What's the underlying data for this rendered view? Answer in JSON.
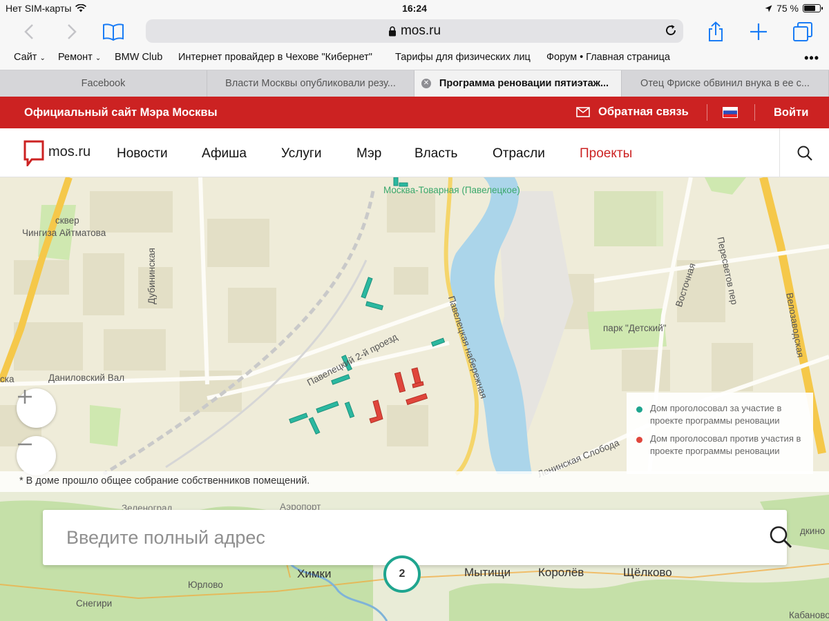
{
  "status_bar": {
    "carrier": "Нет SIM-карты",
    "time": "16:24",
    "battery": "75 %",
    "battery_level": 0.75
  },
  "browser": {
    "url": "mos.ru",
    "bookmarks": [
      "Сайт",
      "Ремонт",
      "BMW Club",
      "Интернет провайдер в Чехове \"Кибернет\"",
      "Тарифы для физических лиц",
      "Форум • Главная страница"
    ],
    "tabs": [
      {
        "title": "Facebook",
        "active": false
      },
      {
        "title": "Власти Москвы опубликовали резу...",
        "active": false
      },
      {
        "title": "Программа реновации пятиэтаж...",
        "active": true
      },
      {
        "title": "Отец Фриске обвинил внука в ее с...",
        "active": false
      }
    ]
  },
  "header": {
    "site_title": "Официальный сайт Мэра Москвы",
    "feedback": "Обратная связь",
    "login": "Войти"
  },
  "nav": {
    "logo_text": "mos.ru",
    "items": [
      "Новости",
      "Афиша",
      "Услуги",
      "Мэр",
      "Власть",
      "Отрасли",
      "Проекты"
    ],
    "active_item": "Проекты"
  },
  "map": {
    "labels": {
      "station": "Москва-Товарная (Павелецкое)",
      "square": "сквер",
      "aitmatov": "Чингиза Айтматова",
      "dubininskaya": "Дубининская",
      "passage": "Павелецкий 2-й проезд",
      "embankment": "Павелецкая набережная",
      "danilovsky": "Даниловский Вал",
      "vostochnaya": "Восточная",
      "peresvetov": "Пересветов пер",
      "park": "парк \"Детский\"",
      "velozavodskaya": "Велозаводская",
      "sloboda": "Ленинская Слобода",
      "ska": "ска",
      "khimki": "Химки",
      "mytishchi": "Мытищи",
      "korolev": "Королёв",
      "shchelkovo": "Щёлково",
      "yurlovo": "Юрлово",
      "snegiri": "Снегири",
      "zelenograd": "Зеленоград",
      "airport": "Аэропорт",
      "lytkino": "дкино",
      "kabanovo": "Кабаново"
    },
    "legend": {
      "for": "Дом проголосовал за участие в проекте программы реновации",
      "against": "Дом проголосовал против участия в проекте программы реновации"
    },
    "legend_colors": {
      "for": "#1fa58f",
      "against": "#e0463c"
    },
    "footnote": "* В доме прошло общее собрание собственников помещений.",
    "address_placeholder": "Введите полный адрес",
    "cluster_count": "2"
  },
  "colors": {
    "brand_red": "#cc2222",
    "teal": "#2bb8a0",
    "red": "#e0463c",
    "river": "#abd5ea"
  }
}
